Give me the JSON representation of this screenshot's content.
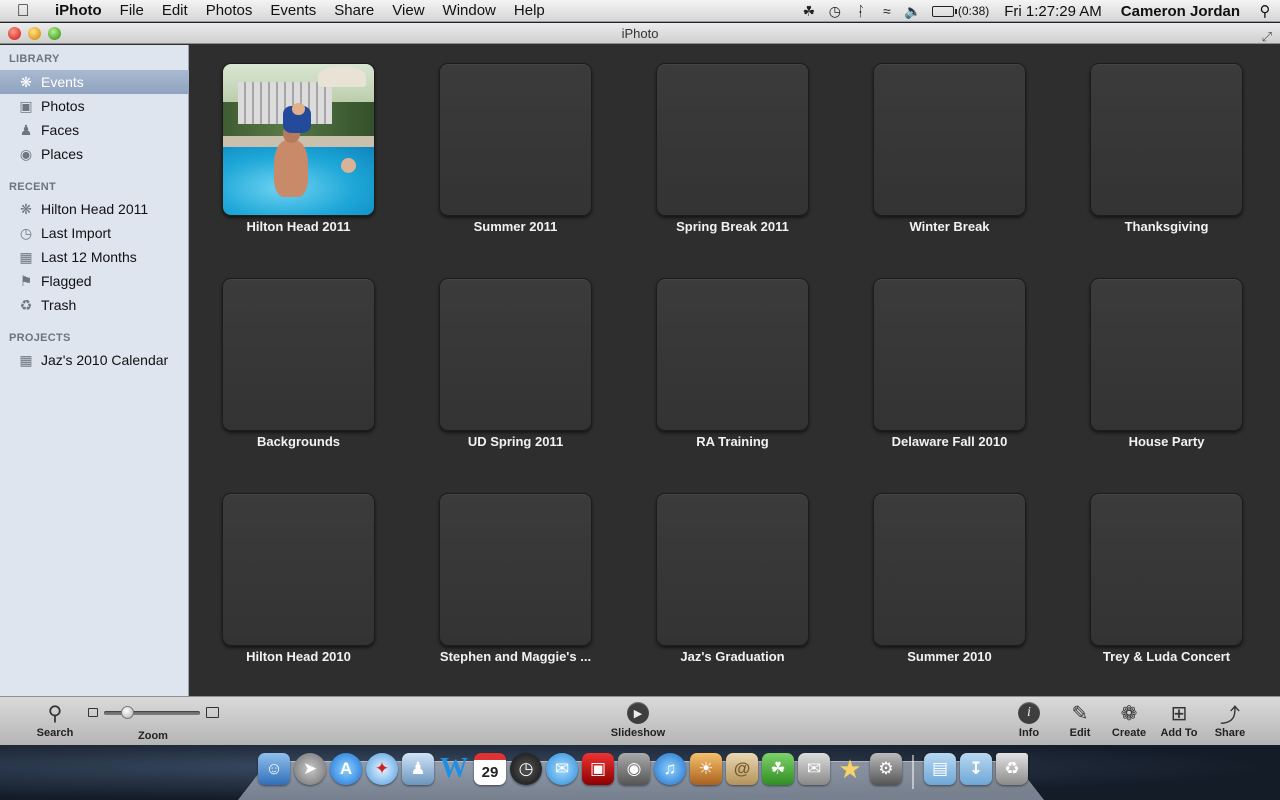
{
  "menubar": {
    "app_name": "iPhoto",
    "menus": [
      "File",
      "Edit",
      "Photos",
      "Events",
      "Share",
      "View",
      "Window",
      "Help"
    ],
    "battery_text": "(0:38)",
    "clock": "Fri 1:27:29 AM",
    "user": "Cameron Jordan"
  },
  "window": {
    "title": "iPhoto"
  },
  "sidebar": {
    "library_header": "LIBRARY",
    "library": [
      {
        "label": "Events",
        "icon": "palm-tree-icon"
      },
      {
        "label": "Photos",
        "icon": "photo-icon"
      },
      {
        "label": "Faces",
        "icon": "person-icon"
      },
      {
        "label": "Places",
        "icon": "globe-icon"
      }
    ],
    "recent_header": "RECENT",
    "recent": [
      {
        "label": "Hilton Head 2011",
        "icon": "palm-tree-icon"
      },
      {
        "label": "Last Import",
        "icon": "clock-icon"
      },
      {
        "label": "Last 12 Months",
        "icon": "calendar-icon"
      },
      {
        "label": "Flagged",
        "icon": "flag-icon"
      },
      {
        "label": "Trash",
        "icon": "trash-icon"
      }
    ],
    "projects_header": "PROJECTS",
    "projects": [
      {
        "label": "Jaz's 2010 Calendar",
        "icon": "calendar-icon"
      }
    ]
  },
  "events": [
    {
      "label": "Hilton Head 2011",
      "has_photo": true
    },
    {
      "label": "Summer 2011"
    },
    {
      "label": "Spring Break 2011"
    },
    {
      "label": "Winter Break"
    },
    {
      "label": "Thanksgiving"
    },
    {
      "label": "Backgrounds"
    },
    {
      "label": "UD Spring 2011"
    },
    {
      "label": "RA Training"
    },
    {
      "label": "Delaware Fall 2010"
    },
    {
      "label": "House Party"
    },
    {
      "label": "Hilton Head 2010"
    },
    {
      "label": "Stephen and Maggie's ..."
    },
    {
      "label": "Jaz's Graduation"
    },
    {
      "label": "Summer 2010"
    },
    {
      "label": "Trey & Luda Concert"
    }
  ],
  "toolbar": {
    "search": "Search",
    "zoom": "Zoom",
    "zoom_level": 0.2,
    "slideshow": "Slideshow",
    "info": "Info",
    "edit": "Edit",
    "create": "Create",
    "add_to": "Add To",
    "share": "Share"
  },
  "dock": {
    "date_badge": "29",
    "apps": [
      "finder-icon",
      "launchpad-icon",
      "app-store-icon",
      "safari-icon",
      "preview-icon",
      "word-icon",
      "calendar-icon",
      "dashboard-icon",
      "messages-icon",
      "photo-booth-icon",
      "facetime-icon",
      "itunes-icon",
      "iphoto-icon",
      "contacts-icon",
      "evernote-icon",
      "mail-photo-icon",
      "imovie-icon",
      "system-preferences-icon",
      "folder-icon",
      "downloads-icon",
      "trash-icon"
    ]
  }
}
